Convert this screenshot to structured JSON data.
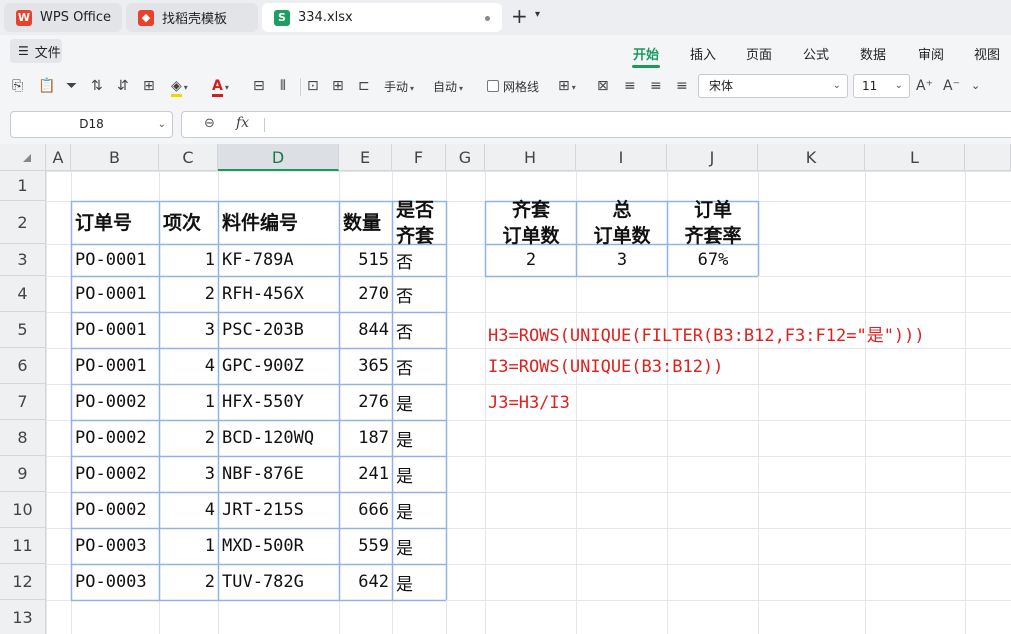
{
  "tabs": [
    {
      "label": "WPS Office"
    },
    {
      "label": "找稻壳模板"
    },
    {
      "label": "334.xlsx"
    }
  ],
  "menu": {
    "file": "文件",
    "items": [
      "开始",
      "插入",
      "页面",
      "公式",
      "数据",
      "审阅",
      "视图"
    ]
  },
  "toolbar": {
    "manual_label": "手动",
    "auto_label": "自动",
    "gridlines_label": "网格线",
    "font_name": "宋体",
    "font_size": "11"
  },
  "formula_bar": {
    "name_box": "D18",
    "fx_symbol": "fx",
    "content": ""
  },
  "sheet": {
    "columns": [
      "A",
      "B",
      "C",
      "D",
      "E",
      "F",
      "G",
      "H",
      "I",
      "J",
      "K",
      "L"
    ],
    "active_column": "D",
    "rows": [
      "1",
      "2",
      "3",
      "4",
      "5",
      "6",
      "7",
      "8",
      "9",
      "10",
      "11",
      "12",
      "13"
    ],
    "main_table": {
      "headers": [
        "订单号",
        "项次",
        "料件编号",
        "数量",
        "是否\n齐套"
      ],
      "rows": [
        [
          "PO-0001",
          "1",
          "KF-789A",
          "515",
          "否"
        ],
        [
          "PO-0001",
          "2",
          "RFH-456X",
          "270",
          "否"
        ],
        [
          "PO-0001",
          "3",
          "PSC-203B",
          "844",
          "否"
        ],
        [
          "PO-0001",
          "4",
          "GPC-900Z",
          "365",
          "否"
        ],
        [
          "PO-0002",
          "1",
          "HFX-550Y",
          "276",
          "是"
        ],
        [
          "PO-0002",
          "2",
          "BCD-120WQ",
          "187",
          "是"
        ],
        [
          "PO-0002",
          "3",
          "NBF-876E",
          "241",
          "是"
        ],
        [
          "PO-0002",
          "4",
          "JRT-215S",
          "666",
          "是"
        ],
        [
          "PO-0003",
          "1",
          "MXD-500R",
          "559",
          "是"
        ],
        [
          "PO-0003",
          "2",
          "TUV-782G",
          "642",
          "是"
        ]
      ]
    },
    "summary_table": {
      "headers": [
        "齐套\n订单数",
        "总\n订单数",
        "订单\n齐套率"
      ],
      "values": [
        "2",
        "3",
        "67%"
      ]
    },
    "formulas": [
      "H3=ROWS(UNIQUE(FILTER(B3:B12,F3:F12=\"是\")))",
      "I3=ROWS(UNIQUE(B3:B12))",
      "J3=H3/I3"
    ]
  },
  "colors": {
    "accent": "#1a9b5d",
    "formula_text": "#e0201c",
    "table_border": "#8fb4e3"
  }
}
